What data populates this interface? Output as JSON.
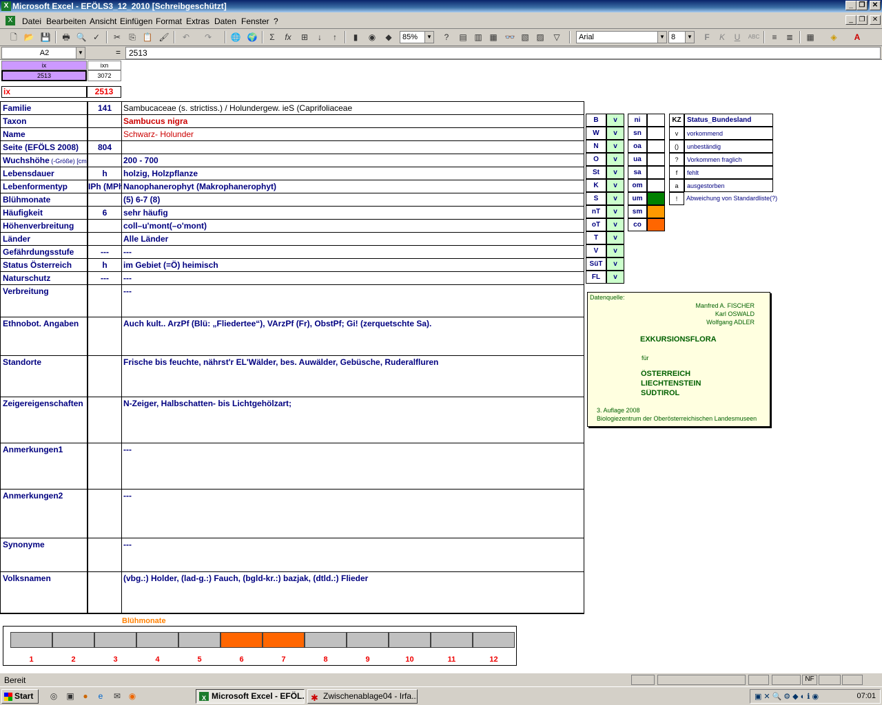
{
  "window": {
    "title": "Microsoft Excel - EFÖLS3_12_2010  [Schreibgeschützt]"
  },
  "menu": [
    "Datei",
    "Bearbeiten",
    "Ansicht",
    "Einfügen",
    "Format",
    "Extras",
    "Daten",
    "Fenster",
    "?"
  ],
  "toolbar": {
    "zoom": "85%",
    "font": "Arial",
    "size": "8"
  },
  "formula": {
    "namebox": "A2",
    "eq": "=",
    "value": "2513"
  },
  "top": {
    "ix_hdr": "ix",
    "ixn_hdr": "ixn",
    "ix_val": "2513",
    "ixn_val": "3072",
    "ix_label": "ix",
    "ix_big": "2513"
  },
  "rows": [
    {
      "label": "Familie",
      "code": "141",
      "value": "Sambucaceae (s. strictiss.)  /  Holundergew. ieS (Caprifoliaceae"
    },
    {
      "label": "Taxon",
      "code": "",
      "value": "Sambucus nigra"
    },
    {
      "label": "Name",
      "code": "",
      "value": "Schwarz- Holunder"
    },
    {
      "label": "Seite (EFÖLS 2008)",
      "code": "804",
      "value": ""
    },
    {
      "label": "Wuchshöhe",
      "label2": " (-Größe) [cm]",
      "code": "",
      "value": " 200 - 700"
    },
    {
      "label": "Lebensdauer",
      "code": "h",
      "value": "holzig, Holzpflanze"
    },
    {
      "label": "Lebenformentyp",
      "code": "IPh (MPh",
      "value": "Nanophanerophyt (Makrophanerophyt)"
    },
    {
      "label": "Blühmonate",
      "code": "",
      "value": "(5) 6-7 (8)"
    },
    {
      "label": "Häufigkeit",
      "code": "6",
      "value": "sehr häufig"
    },
    {
      "label": "Höhenverbreitung",
      "code": "",
      "value": "coll–u'mont(–o'mont)"
    },
    {
      "label": "Länder",
      "code": "",
      "value": " Alle Länder"
    },
    {
      "label": "Gefährdungsstufe",
      "code": "---",
      "value": "  ---"
    },
    {
      "label": "Status Österreich",
      "code": "h",
      "value": "im Gebiet (=Ö) heimisch"
    },
    {
      "label": "Naturschutz",
      "code": "---",
      "value": " ---"
    },
    {
      "label": "Verbreitung",
      "code": "",
      "value": " ---"
    },
    {
      "label": "Ethnobot. Angaben",
      "code": "",
      "value": "Auch kult.. ArzPf (Blü: „Fliedertee“), VArzPf (Fr), ObstPf; Gi! (zerquetschte Sa)."
    },
    {
      "label": "Standorte",
      "code": "",
      "value": "Frische bis feuchte, nährst'r EL'Wälder, bes. Auwälder, Gebüsche, Ruderalfluren"
    },
    {
      "label": "Zeigereigenschaften",
      "code": "",
      "value": "N-Zeiger, Halbschatten- bis Lichtgehölzart;"
    },
    {
      "label": "Anmerkungen1",
      "code": "",
      "value": "---"
    },
    {
      "label": "Anmerkungen2",
      "code": "",
      "value": "---"
    },
    {
      "label": "Synonyme",
      "code": "",
      "value": "---"
    },
    {
      "label": "Volksnamen",
      "code": "",
      "value": "(vbg.:) Holder, (lad-g.:) Fauch, (bgld-kr.:) bazjak, (dtld.:) Flieder"
    }
  ],
  "regions": [
    {
      "k": "B",
      "v": "v"
    },
    {
      "k": "W",
      "v": "v"
    },
    {
      "k": "N",
      "v": "v"
    },
    {
      "k": "O",
      "v": "v"
    },
    {
      "k": "St",
      "v": "v"
    },
    {
      "k": "K",
      "v": "v"
    },
    {
      "k": "S",
      "v": "v"
    },
    {
      "k": "nT",
      "v": "v"
    },
    {
      "k": "oT",
      "v": "v"
    },
    {
      "k": "T",
      "v": "v"
    },
    {
      "k": "V",
      "v": "v"
    },
    {
      "k": "SüT",
      "v": "v"
    },
    {
      "k": "FL",
      "v": "v"
    }
  ],
  "alt": [
    {
      "k": "ni",
      "c": ""
    },
    {
      "k": "sn",
      "c": ""
    },
    {
      "k": "oa",
      "c": ""
    },
    {
      "k": "ua",
      "c": ""
    },
    {
      "k": "sa",
      "c": ""
    },
    {
      "k": "om",
      "c": ""
    },
    {
      "k": "um",
      "c": "#008000"
    },
    {
      "k": "sm",
      "c": "#ff9900"
    },
    {
      "k": "co",
      "c": "#ff6600"
    }
  ],
  "status": {
    "hdr_k": "KZ",
    "hdr_v": "Status_Bundesland",
    "items": [
      {
        "k": "v",
        "v": "vorkommend"
      },
      {
        "k": "()",
        "v": "unbeständig"
      },
      {
        "k": "?",
        "v": "Vorkommen fraglich"
      },
      {
        "k": "f",
        "v": "fehlt"
      },
      {
        "k": "a",
        "v": "ausgestorben"
      },
      {
        "k": "!",
        "v": "Abweichung von Standardliste(?)"
      }
    ]
  },
  "source": {
    "label": "Datenquelle:",
    "a1": "Manfred A. FISCHER",
    "a2": "Karl OSWALD",
    "a3": "Wolfgang ADLER",
    "title": "EXKURSIONSFLORA",
    "fuer": "für",
    "c1": "ÖSTERREICH",
    "c2": "LIECHTENSTEIN",
    "c3": "SÜDTIROL",
    "ed": "3. Auflage 2008",
    "pub": "Biologiezentrum der Oberösterreichischen Landesmuseen"
  },
  "months": {
    "title": "Blühmonate",
    "labels": [
      "1",
      "2",
      "3",
      "4",
      "5",
      "6",
      "7",
      "8",
      "9",
      "10",
      "11",
      "12"
    ],
    "active": [
      false,
      false,
      false,
      false,
      false,
      true,
      true,
      false,
      false,
      false,
      false,
      false
    ]
  },
  "statusbar": {
    "text": "Bereit",
    "nf": "NF"
  },
  "taskbar": {
    "start": "Start",
    "t1": "Microsoft Excel - EFÖL...",
    "t2": "Zwischenablage04 - Irfa...",
    "clock": "07:01"
  }
}
